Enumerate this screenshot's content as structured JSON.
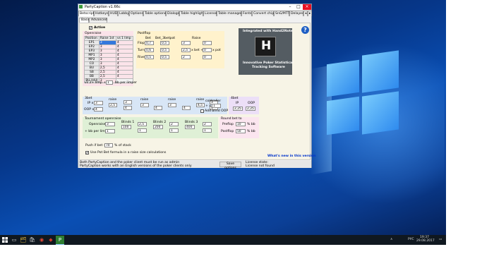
{
  "window": {
    "title": "PartyCaption v1.66c",
    "tabs": [
      "Betscript",
      "Hotkeys",
      "HUD",
      "Lobby",
      "Options",
      "Table options",
      "Dialogs",
      "Table highlight",
      "License",
      "Table manager",
      "Fonts",
      "Convert chips",
      "SnG/MTT",
      "Delayed"
    ],
    "subtabs": [
      "Basic",
      "Advanced"
    ],
    "minimize": "–",
    "maximize": "□",
    "close": "×",
    "scroll_left": "◂",
    "scroll_right": "▸"
  },
  "active": {
    "checkbox": "✔",
    "label": "Active"
  },
  "openraise": {
    "title": "Openraise",
    "headers": [
      "Position",
      "Raise 1st",
      "vs 1 limp"
    ],
    "rows": [
      {
        "pos": "EP1",
        "raise": "3",
        "limp": "4"
      },
      {
        "pos": "EP2",
        "raise": "3",
        "limp": "4"
      },
      {
        "pos": "EP3",
        "raise": "3",
        "limp": "4"
      },
      {
        "pos": "MP1",
        "raise": "3",
        "limp": "4"
      },
      {
        "pos": "MP2",
        "raise": "3",
        "limp": "4"
      },
      {
        "pos": "CO",
        "raise": "3",
        "limp": "4"
      },
      {
        "pos": "BU",
        "raise": "2,5",
        "limp": "4"
      },
      {
        "pos": "SB",
        "raise": "2,5",
        "limp": "4"
      },
      {
        "pos": "BB",
        "raise": "2,5",
        "limp": "4"
      },
      {
        "pos": "BU (HU)",
        "raise": "3",
        "limp": ""
      }
    ],
    "vs_limp_prefix": "vs 2+ limp +",
    "vs_limp_value": "1",
    "vs_limp_suffix": "bb per limper"
  },
  "postflop": {
    "title": "Postflop",
    "bet_header": "Bet",
    "bet_3betpot_header": "Bet_3betpot",
    "raise_header": "Raise",
    "streets": [
      {
        "name": "Flop",
        "bet": "0,7",
        "bet3": "0,5",
        "raise_a": "3",
        "raise_b": "0"
      },
      {
        "name": "Turn",
        "bet": "0,6",
        "bet3": "0,5",
        "raise_a": "2,5",
        "raise_b": "0"
      },
      {
        "name": "River",
        "bet": "0,5",
        "bet3": "0,5",
        "raise_a": "2",
        "raise_b": "0"
      }
    ],
    "x_bet": "x bet +",
    "x_pot": "x pot"
  },
  "promo": {
    "header": "Integrated with Hand2Note",
    "logo_letter": "H",
    "caption_line1": "Innovative Poker Statistical",
    "caption_line2": "Tracking Software"
  },
  "help_icon": "?",
  "threebet": {
    "title": "3bet",
    "ip_label": "IP x",
    "ip": "3",
    "oop_label": "OOP x",
    "oop": "4",
    "raise_label": "raise",
    "steps": [
      {
        "raise": "2,5",
        "limit": "3",
        "after": "4"
      },
      {
        "raise": "3",
        "limit": "",
        "after": "4"
      },
      {
        "raise": "3",
        "limit": "",
        "after": "4"
      },
      {
        "raise": "4,5",
        "limit": "",
        "after": "4"
      },
      {
        "raise": "3",
        "limit": "",
        "after": "4"
      }
    ],
    "coldcaller_label": "coldcaller",
    "coldcaller_prefix": "+ x",
    "coldcaller": "1",
    "add_blind_label": "Add blind OOP"
  },
  "fourbet": {
    "title": "4bet",
    "ip_label": "IP",
    "oop_label": "OOP",
    "ip": "2,25",
    "oop": "2,25"
  },
  "tournament": {
    "title": "Tournament openraise",
    "openraise_label": "Openraise",
    "openraise": "3",
    "bb_per_limp_label": "+ bb per limp",
    "bb_per_limp": "1",
    "blinds_label": "Blinds",
    "blind_label_1": "Blinds 1",
    "blind_label_2": "Blinds 2",
    "blind_label_3": "Blinds 3",
    "b1": "100",
    "b1x": "2,5",
    "b1y": "1",
    "b2": "200",
    "b2x": "2",
    "b2y": "1",
    "b3": "400",
    "b3x": "2",
    "b3y": "1"
  },
  "roundbet": {
    "title": "Round bet to",
    "preflop_label": "Preflop",
    "preflop": "10",
    "postflop_label": "Postflop",
    "postflop": "50",
    "unit": "% bb"
  },
  "push": {
    "prefix": "Push if bet >",
    "value": "70",
    "suffix": "% of stack"
  },
  "potbet": {
    "checkbox": "✔",
    "label": "Use Pot Bet formula in a raise size calculations"
  },
  "whats_new": "What's new in this version",
  "status": {
    "line1": "Both PartyCaption and the poker client must be run as admin",
    "line2": "PartyCaption works with an English versions of the poker clients only",
    "save_button": "Save options",
    "license_state": "License state:",
    "license_value": "License not found"
  },
  "taskbar": {
    "start_icon": "windows-start-icon",
    "items": [
      "▭",
      "🗂",
      "🛍",
      "◉",
      "◆",
      "P"
    ],
    "tray_arrow": "∧",
    "lang": "РУС",
    "time": "19:37",
    "date": "29.08.2017",
    "notify_icon": "▭"
  },
  "colors": {
    "desktop": "#0a4fb4",
    "openraise_bg": "#fbe3e9",
    "postflop_bg": "#fff2cc",
    "threebet_bg": "#d8e6f6",
    "fourbet_bg": "#ecdff7",
    "tournament_bg": "#dff0d6",
    "roundbet_bg": "#fbe5ef",
    "promo_bg": "#545c62",
    "link": "#0033cc"
  }
}
